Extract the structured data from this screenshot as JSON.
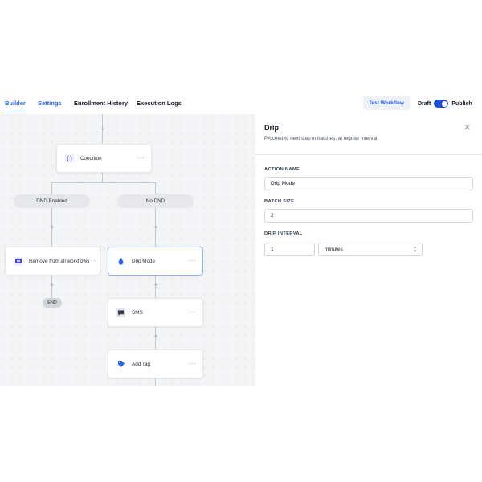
{
  "tabs": [
    {
      "label": "Builder"
    },
    {
      "label": "Settings"
    },
    {
      "label": "Enrollment History"
    },
    {
      "label": "Execution Logs"
    }
  ],
  "header": {
    "test_button": "Test Workflow",
    "draft_label": "Draft",
    "publish_label": "Publish",
    "publish_toggle_on": true
  },
  "canvas": {
    "condition_node": {
      "label": "Condition",
      "icon": "braces-icon"
    },
    "branches": [
      "DND Enabled",
      "No DND"
    ],
    "remove_node": {
      "label": "Remove from all workflows",
      "icon": "workflow-remove-icon"
    },
    "end_label": "END",
    "drip_node": {
      "label": "Drip Mode",
      "icon": "drip-icon"
    },
    "sms_node": {
      "label": "SMS",
      "icon": "chat-icon"
    },
    "tag_node": {
      "label": "Add Tag",
      "icon": "tag-icon"
    },
    "more_glyph": "···",
    "plus_glyph": "+"
  },
  "panel": {
    "title": "Drip",
    "subtitle": "Proceed to next step in batches, at regular interval.",
    "close_glyph": "✕",
    "action_name_label": "ACTION NAME",
    "action_name_value": "Drip Mode",
    "batch_size_label": "BATCH SIZE",
    "batch_size_value": "2",
    "drip_interval_label": "DRIP INTERVAL",
    "drip_interval_value": "1",
    "drip_interval_unit": "minutes"
  },
  "colors": {
    "accent": "#2563eb",
    "canvas_bg": "#f3f4f6"
  }
}
